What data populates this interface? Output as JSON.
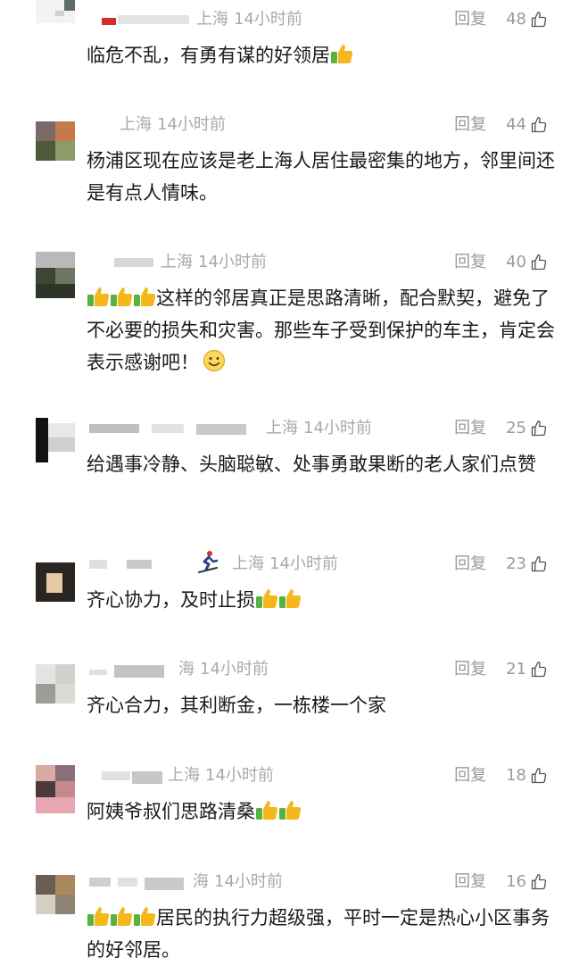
{
  "comments": [
    {
      "location": "上海",
      "time": "14小时前",
      "reply_label": "回复",
      "likes": "48",
      "text": "临危不乱，有勇有谋的好领居",
      "thumbs_after": 1
    },
    {
      "location": "上海",
      "time": "14小时前",
      "reply_label": "回复",
      "likes": "44",
      "text": "杨浦区现在应该是老上海人居住最密集的地方，邻里间还是有点人情味。",
      "thumbs_after": 0
    },
    {
      "location": "上海",
      "time": "14小时前",
      "reply_label": "回复",
      "likes": "40",
      "text": "这样的邻居真正是思路清晰，配合默契，避免了不必要的损失和灾害。那些车子受到保护的车主，肯定会表示感谢吧！",
      "thumbs_before": 3,
      "smile_after": true
    },
    {
      "location": "上海",
      "time": "14小时前",
      "reply_label": "回复",
      "likes": "25",
      "text": "给遇事冷静、头脑聪敏、处事勇敢果断的老人家们点赞"
    },
    {
      "location": "上海",
      "time": "14小时前",
      "reply_label": "回复",
      "likes": "23",
      "text": "齐心协力，及时止损",
      "thumbs_after": 2,
      "badge": "skier-icon"
    },
    {
      "location": "海",
      "time": "14小时前",
      "reply_label": "回复",
      "likes": "21",
      "text": "齐心合力，其利断金，一栋楼一个家"
    },
    {
      "location": "上海",
      "time": "14小时前",
      "reply_label": "回复",
      "likes": "18",
      "text": "阿姨爷叔们思路清桑",
      "thumbs_after": 2
    },
    {
      "location": "海",
      "time": "14小时前",
      "reply_label": "回复",
      "likes": "16",
      "text": "居民的执行力超级强，平时一定是热心小区事务的好邻居。",
      "thumbs_before": 3
    }
  ],
  "icons": {
    "like": "thumbs-up-outline-icon",
    "emoji_thumb": "thumbs-up-emoji-icon",
    "emoji_smile": "smiling-face-emoji-icon"
  },
  "colors": {
    "text": "#1a1a1a",
    "meta": "#a9a9a9",
    "thumb_yellow": "#f5b81c",
    "thumb_green": "#58b23f"
  }
}
